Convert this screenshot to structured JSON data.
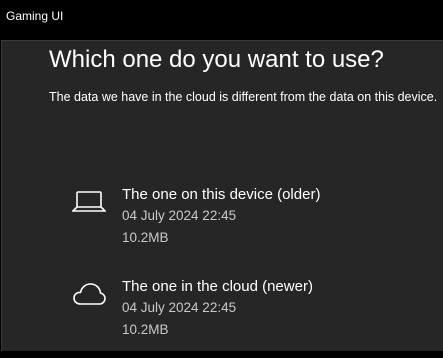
{
  "window": {
    "title": "Gaming UI"
  },
  "dialog": {
    "heading": "Which one do you want to use?",
    "description": "The data we have in the cloud is different from the data on this device."
  },
  "options": [
    {
      "icon": "laptop-icon",
      "label": "The one on this device (older)",
      "date": "04 July 2024 22:45",
      "size": "10.2MB"
    },
    {
      "icon": "cloud-icon",
      "label": "The one in the cloud (newer)",
      "date": "04 July 2024 22:45",
      "size": "10.2MB"
    }
  ],
  "colors": {
    "background": "#000000",
    "dialog": "#262626",
    "text": "#ffffff",
    "secondary_text": "#c8c8c8"
  }
}
